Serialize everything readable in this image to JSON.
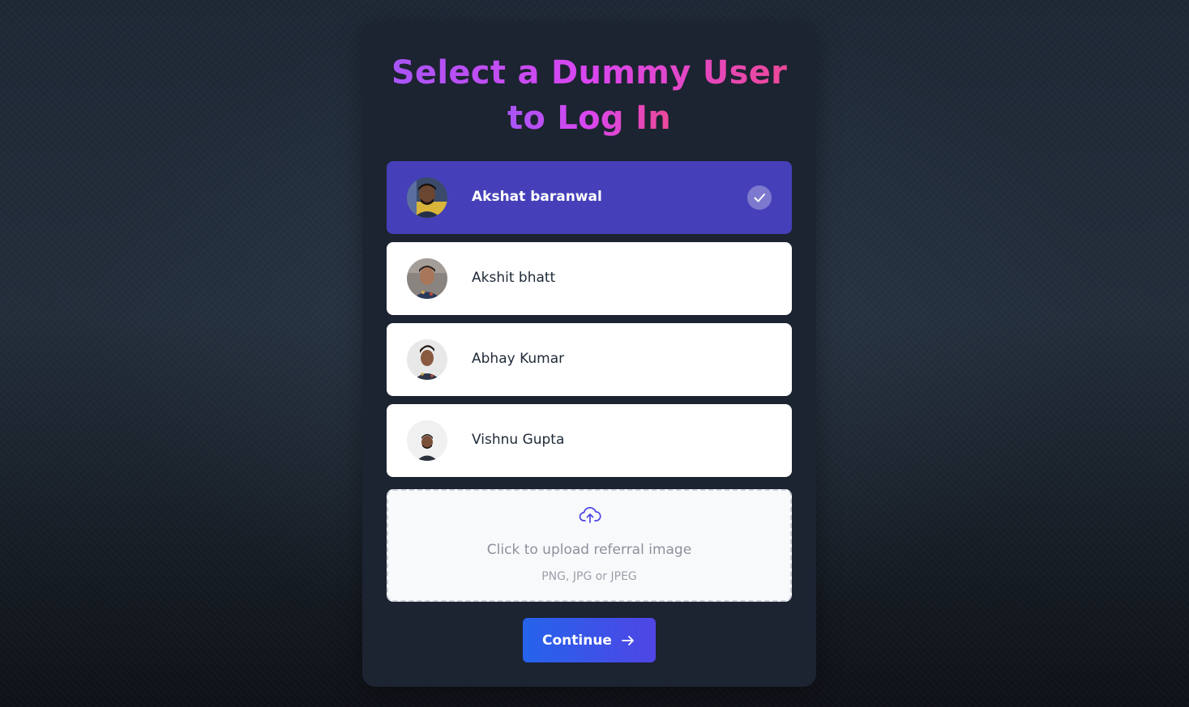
{
  "title": {
    "line1": "Select a Dummy User",
    "line2": "to Log In"
  },
  "users": [
    {
      "name": "Akshat baranwal",
      "selected": true,
      "avatar_icon": "user-photo"
    },
    {
      "name": "Akshit bhatt",
      "selected": false,
      "avatar_icon": "user-photo"
    },
    {
      "name": "Abhay Kumar",
      "selected": false,
      "avatar_icon": "user-photo"
    },
    {
      "name": "Vishnu Gupta",
      "selected": false,
      "avatar_icon": "user-photo"
    }
  ],
  "upload": {
    "title": "Click to upload referral image",
    "subtitle": "PNG, JPG or JPEG",
    "icon": "cloud-upload-icon"
  },
  "continue": {
    "label": "Continue",
    "icon": "arrow-right-icon"
  },
  "colors": {
    "selected_bg": "#4540b9",
    "title_gradient_start": "#a855f7",
    "title_gradient_end": "#ec4899",
    "button_gradient_start": "#2563eb",
    "button_gradient_end": "#4f46e5",
    "card_bg": "#1c2331"
  }
}
